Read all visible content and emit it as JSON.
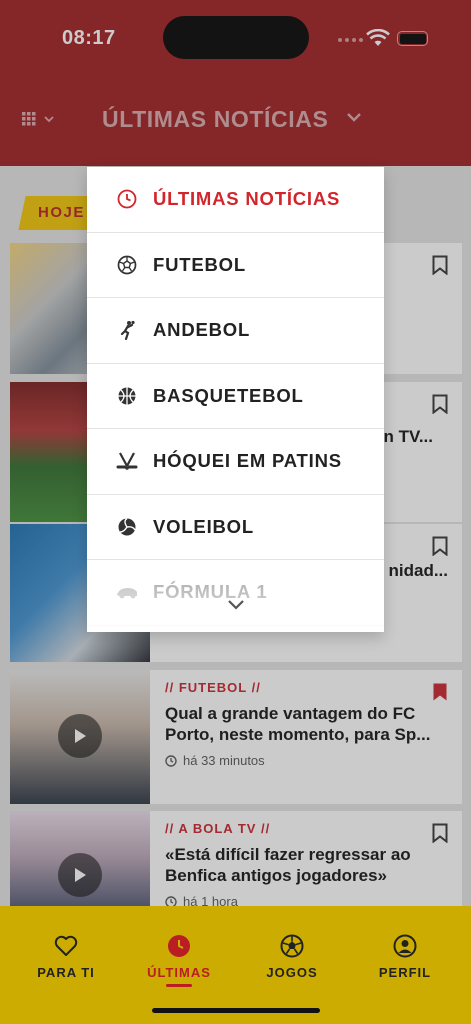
{
  "status_bar": {
    "time": "08:17"
  },
  "header": {
    "title": "ÚLTIMAS NOTÍCIAS"
  },
  "feed": {
    "section_tag": "HOJE",
    "articles": [
      {
        "category": "",
        "title": "",
        "time": ""
      },
      {
        "category": "",
        "title": "n TV...",
        "time": ""
      },
      {
        "category": "",
        "title": "le: nidad...",
        "time": ""
      },
      {
        "category": "// FUTEBOL //",
        "title": "Qual a grande vantagem do FC Porto, neste momento, para Sp...",
        "time": "há 33 minutos"
      },
      {
        "category": "// A BOLA TV //",
        "title": "«Está difícil fazer regressar ao Benfica antigos jogadores»",
        "time": "há 1 hora"
      }
    ]
  },
  "menu": {
    "items": [
      {
        "label": "ÚLTIMAS NOTÍCIAS",
        "icon": "clock-icon",
        "active": true
      },
      {
        "label": "FUTEBOL",
        "icon": "soccer-ball-icon"
      },
      {
        "label": "ANDEBOL",
        "icon": "handball-icon"
      },
      {
        "label": "BASQUETEBOL",
        "icon": "basketball-icon"
      },
      {
        "label": "HÓQUEI EM PATINS",
        "icon": "hockey-sticks-icon"
      },
      {
        "label": "VOLEIBOL",
        "icon": "volleyball-icon"
      },
      {
        "label": "FÓRMULA 1",
        "icon": "formula1-icon"
      }
    ]
  },
  "tabbar": {
    "tabs": [
      {
        "label": "PARA TI",
        "icon": "heart-icon"
      },
      {
        "label": "ÚLTIMAS",
        "icon": "clock-icon",
        "active": true
      },
      {
        "label": "JOGOS",
        "icon": "soccer-ball-icon"
      },
      {
        "label": "PERFIL",
        "icon": "profile-icon"
      }
    ]
  },
  "colors": {
    "brand_red": "#9e1b1e",
    "accent_red": "#d2252c",
    "tabbar_yellow": "#ccac00",
    "tag_yellow": "#f2c400"
  }
}
